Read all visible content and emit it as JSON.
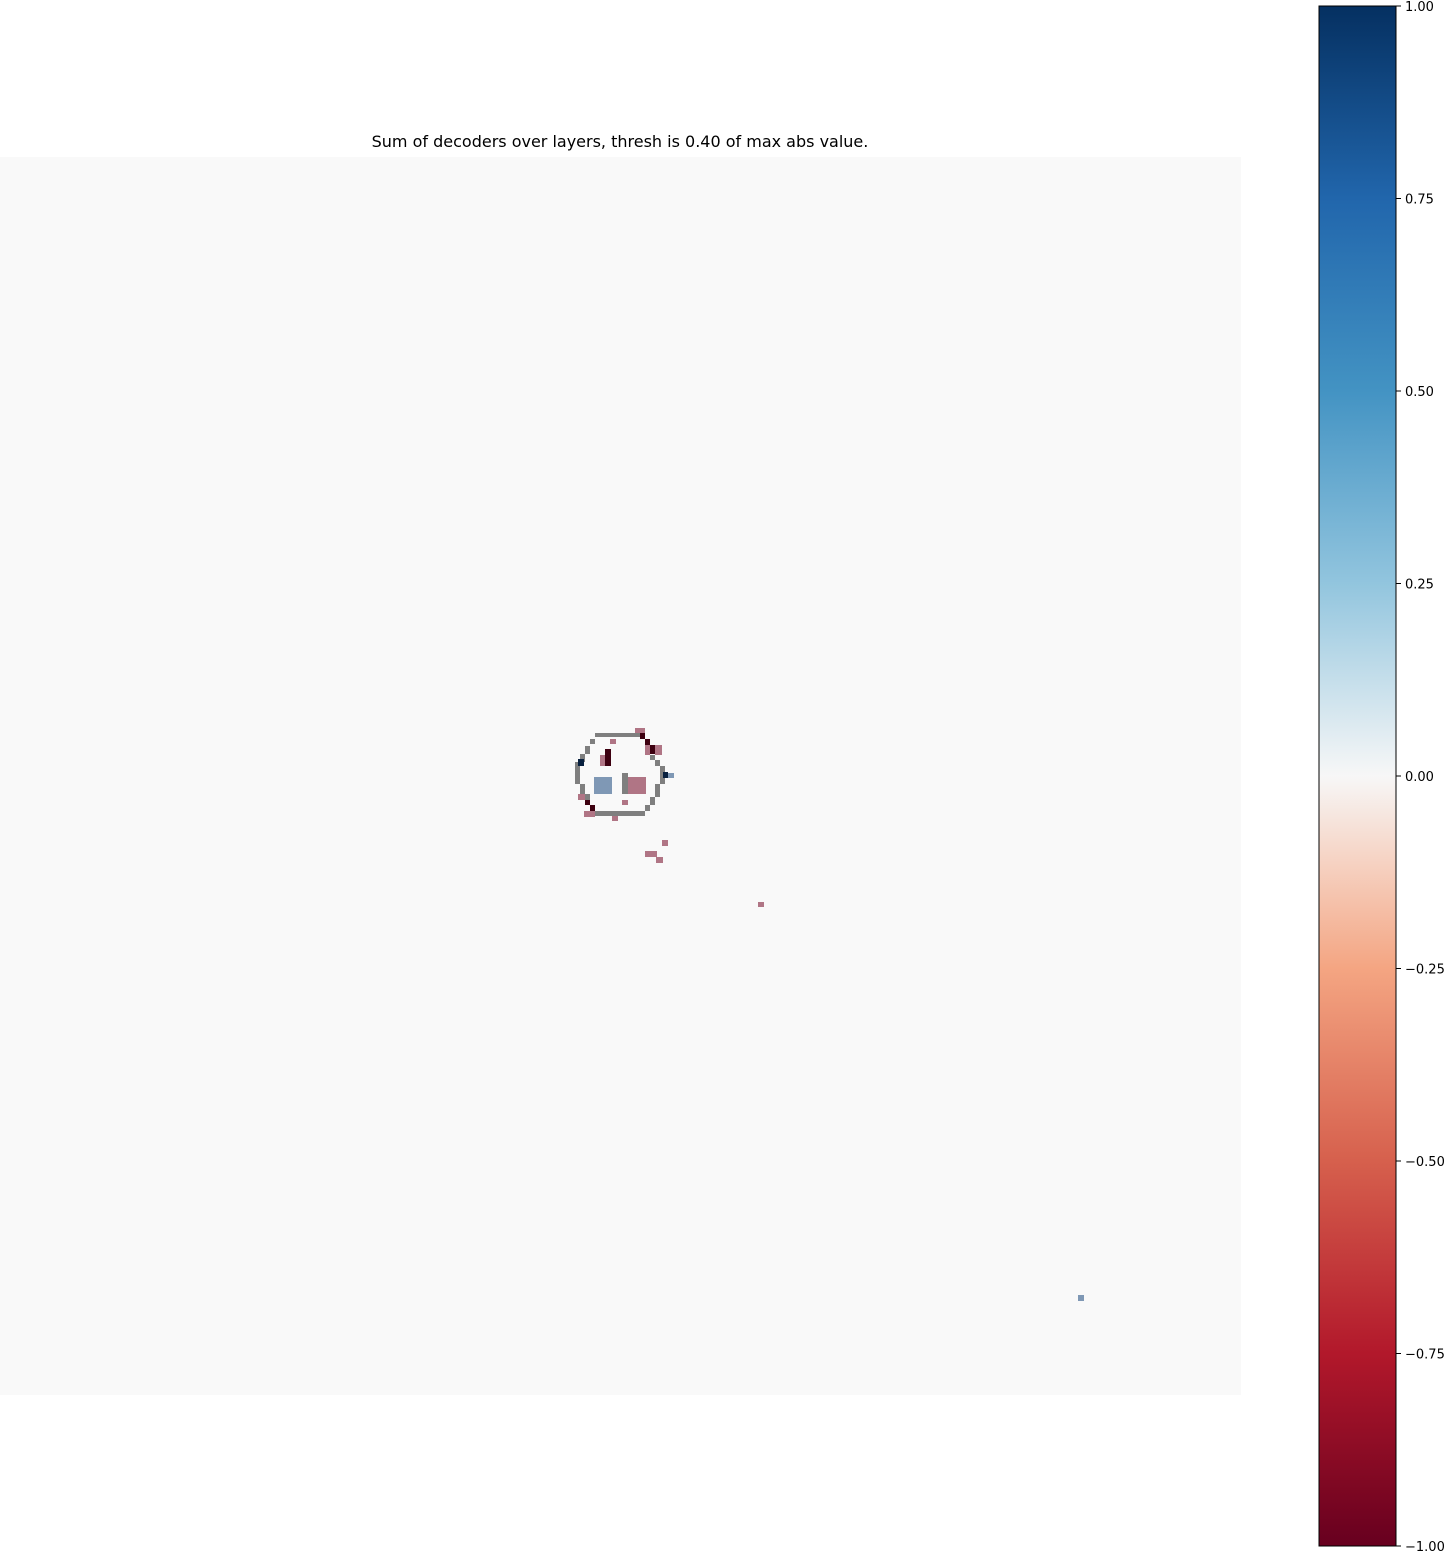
{
  "chart_data": {
    "type": "heatmap",
    "title": "Sum of decoders over layers, thresh is 0.40 of max abs value.",
    "colormap": "RdBu",
    "background_color": "#f9f9f9",
    "overlay_outline_color": "#7f7f7f",
    "axes_visible": false,
    "colorbar": {
      "position": "right",
      "vmin": -1.0,
      "vmax": 1.0,
      "tick_values": [
        1.0,
        0.75,
        0.5,
        0.25,
        0.0,
        -0.25,
        -0.5,
        -0.75,
        -1.0
      ],
      "tick_labels": [
        "1.00",
        "0.75",
        "0.50",
        "0.25",
        "0.00",
        "−0.25",
        "−0.50",
        "−0.75",
        "−1.00"
      ]
    }
  }
}
